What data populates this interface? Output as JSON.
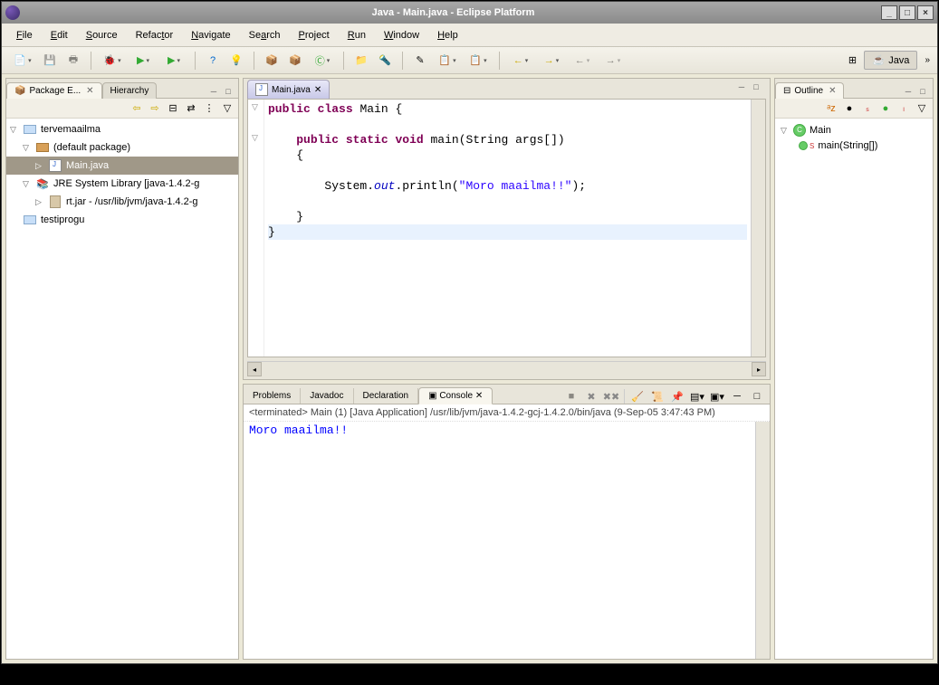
{
  "window": {
    "title": "Java - Main.java - Eclipse Platform"
  },
  "menu": {
    "file": "File",
    "edit": "Edit",
    "source": "Source",
    "refactor": "Refactor",
    "navigate": "Navigate",
    "search": "Search",
    "project": "Project",
    "run": "Run",
    "window": "Window",
    "help": "Help"
  },
  "perspective": {
    "java": "Java"
  },
  "packageExplorer": {
    "title": "Package E...",
    "hierarchyTab": "Hierarchy",
    "items": {
      "project": "tervemaailma",
      "defaultPkg": "(default package)",
      "mainJava": "Main.java",
      "jre": "JRE System Library [java-1.4.2-g",
      "rtjar": "rt.jar - /usr/lib/jvm/java-1.4.2-g",
      "testiprogu": "testiprogu"
    }
  },
  "editor": {
    "tabName": "Main.java",
    "code": {
      "l1_kw1": "public",
      "l1_kw2": "class",
      "l1_rest": " Main {",
      "l3_indent": "    ",
      "l3_kw1": "public",
      "l3_kw2": "static",
      "l3_kw3": "void",
      "l3_rest": " main(String args[])",
      "l4": "    {",
      "l6_pre": "        System.",
      "l6_out": "out",
      "l6_mid": ".println(",
      "l6_str": "\"Moro maailma!!\"",
      "l6_post": ");",
      "l8": "    }",
      "l9": "}"
    }
  },
  "outline": {
    "title": "Outline",
    "class": "Main",
    "method": "main(String[])"
  },
  "bottomTabs": {
    "problems": "Problems",
    "javadoc": "Javadoc",
    "declaration": "Declaration",
    "console": "Console"
  },
  "console": {
    "info": "<terminated> Main (1) [Java Application] /usr/lib/jvm/java-1.4.2-gcj-1.4.2.0/bin/java (9-Sep-05 3:47:43 PM)",
    "output": "Moro maailma!!"
  }
}
